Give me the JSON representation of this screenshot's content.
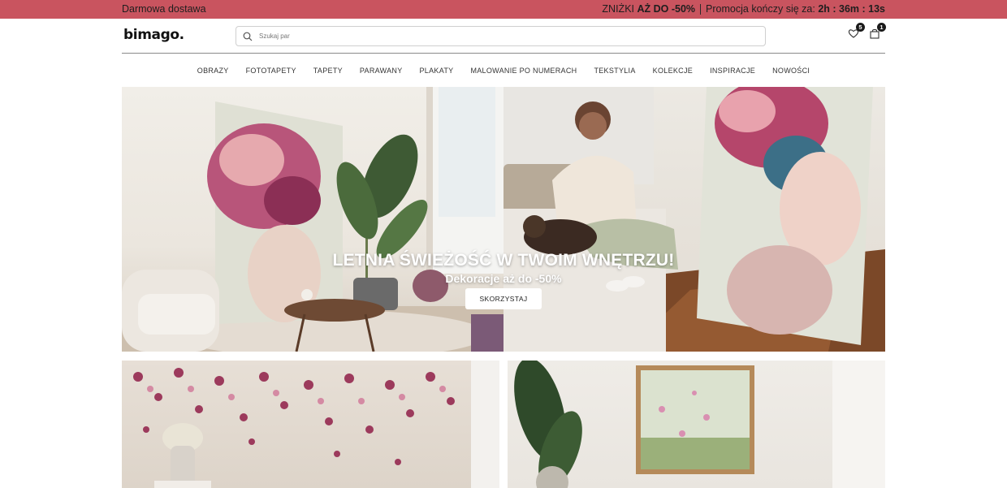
{
  "promo": {
    "left_text": "Darmowa dostawa",
    "discount_prefix": "ZNIŻKI",
    "discount_strong": "AŻ DO -50%",
    "ends_label": "Promocja kończy się za:",
    "timer": "2h : 36m : 13s"
  },
  "header": {
    "logo": "bimago.",
    "search_placeholder": "Szukaj par",
    "wishlist_count": "5",
    "cart_count": "1"
  },
  "nav": {
    "items": [
      "OBRAZY",
      "FOTOTAPETY",
      "TAPETY",
      "PARAWANY",
      "PLAKATY",
      "MALOWANIE PO NUMERACH",
      "TEKSTYLIA",
      "KOLEKCJE",
      "INSPIRACJE",
      "NOWOŚCI"
    ]
  },
  "hero": {
    "title": "LETNIA ŚWIEŻOŚĆ W TWOIM WNĘTRZU!",
    "subtitle": "Dekoracje aż do -50%",
    "cta": "SKORZYSTAJ"
  },
  "colors": {
    "promo_bg": "#c9545f",
    "text_dark": "#222222"
  }
}
